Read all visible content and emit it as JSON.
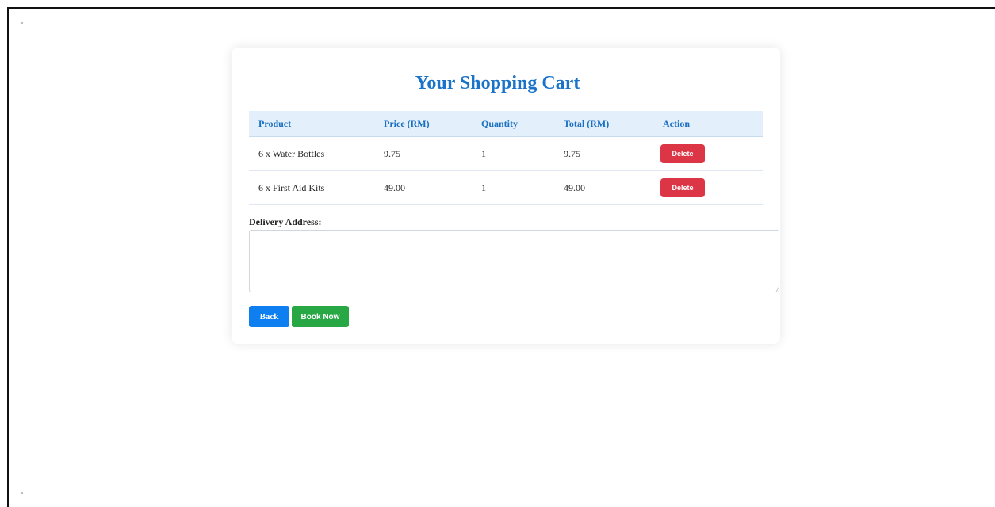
{
  "cart": {
    "title": "Your Shopping Cart",
    "columns": [
      "Product",
      "Price (RM)",
      "Quantity",
      "Total (RM)",
      "Action"
    ],
    "rows": [
      {
        "product": "6 x Water Bottles",
        "price": "9.75",
        "quantity": "1",
        "total": "9.75",
        "action": "Delete"
      },
      {
        "product": "6 x First Aid Kits",
        "price": "49.00",
        "quantity": "1",
        "total": "49.00",
        "action": "Delete"
      }
    ]
  },
  "delivery": {
    "label": "Delivery Address:",
    "value": ""
  },
  "buttons": {
    "back": "Back",
    "book_now": "Book Now"
  },
  "colors": {
    "title": "#1a73c8",
    "header_bg": "#e3effb",
    "delete": "#dc3545",
    "back": "#0d7ff0",
    "book_now": "#28a745"
  }
}
